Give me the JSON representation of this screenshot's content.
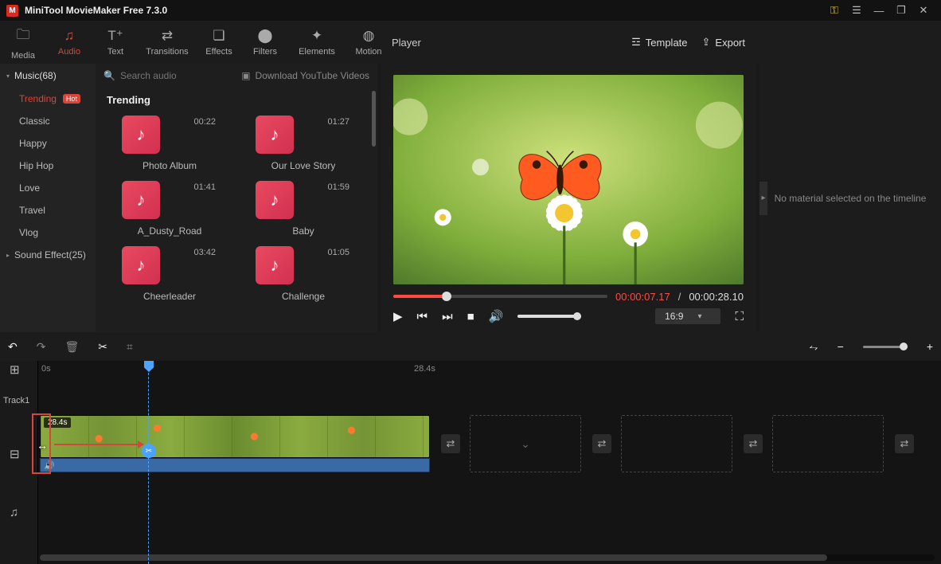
{
  "app": {
    "title": "MiniTool MovieMaker Free 7.3.0"
  },
  "top_tabs": {
    "media": "Media",
    "audio": "Audio",
    "text": "Text",
    "transitions": "Transitions",
    "effects": "Effects",
    "filters": "Filters",
    "elements": "Elements",
    "motion": "Motion"
  },
  "sidebar": {
    "music_header": "Music(68)",
    "items": [
      {
        "label": "Trending",
        "hot": "Hot"
      },
      {
        "label": "Classic"
      },
      {
        "label": "Happy"
      },
      {
        "label": "Hip Hop"
      },
      {
        "label": "Love"
      },
      {
        "label": "Travel"
      },
      {
        "label": "Vlog"
      }
    ],
    "sound_effect_header": "Sound Effect(25)"
  },
  "library": {
    "search_placeholder": "Search audio",
    "download_label": "Download YouTube Videos",
    "section_title": "Trending",
    "thumbs": [
      {
        "duration": "00:22",
        "title": "Photo Album"
      },
      {
        "duration": "01:27",
        "title": "Our Love Story"
      },
      {
        "duration": "01:41",
        "title": "A_Dusty_Road"
      },
      {
        "duration": "01:59",
        "title": "Baby"
      },
      {
        "duration": "03:42",
        "title": "Cheerleader"
      },
      {
        "duration": "01:05",
        "title": "Challenge"
      }
    ]
  },
  "player": {
    "header_label": "Player",
    "template_label": "Template",
    "export_label": "Export",
    "current_time": "00:00:07.17",
    "time_separator": "/",
    "total_time": "00:00:28.10",
    "aspect": "16:9",
    "progress_pct": 25
  },
  "inspector": {
    "empty_msg": "No material selected on the timeline"
  },
  "timeline": {
    "ruler": {
      "t0": "0s",
      "t1": "28.4s"
    },
    "track1_label": "Track1",
    "clip_duration_badge": "28.4s"
  }
}
